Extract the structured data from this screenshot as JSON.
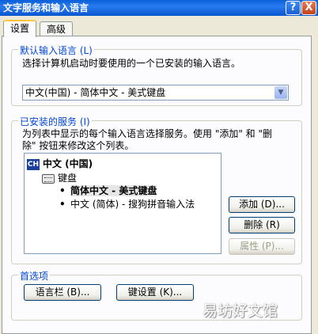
{
  "window": {
    "title": "文字服务和输入语言",
    "help_glyph": "?",
    "close_glyph": "X"
  },
  "tabs": [
    {
      "label": "设置",
      "active": true
    },
    {
      "label": "高级",
      "active": false
    }
  ],
  "default_language": {
    "group_title": "默认输入语言 (L)",
    "description": "选择计算机启动时要使用的一个已安装的输入语言。",
    "selected_value": "中文(中国) - 简体中文 - 美式键盘"
  },
  "installed_services": {
    "group_title": "已安装的服务 (I)",
    "description_line1": "为列表中显示的每个输入语言选择服务。使用 \"添加\" 和 \"删",
    "description_line2": "除\" 按钮来修改这个列表。",
    "tree": {
      "language_badge": "CH",
      "language": "中文 (中国)",
      "category": "键盘",
      "items": [
        {
          "label": "简体中文 - 美式键盘",
          "selected": true
        },
        {
          "label": "中文 (简体) - 搜狗拼音输入法",
          "selected": false
        }
      ]
    },
    "buttons": {
      "add": "添加 (D)...",
      "remove": "删除 (R)",
      "properties": "属性 (P)..."
    }
  },
  "preferences": {
    "group_title": "首选项",
    "language_bar_button": "语言栏 (B)...",
    "key_settings_button": "键设置 (K)..."
  },
  "watermark": "易坊好文馆"
}
